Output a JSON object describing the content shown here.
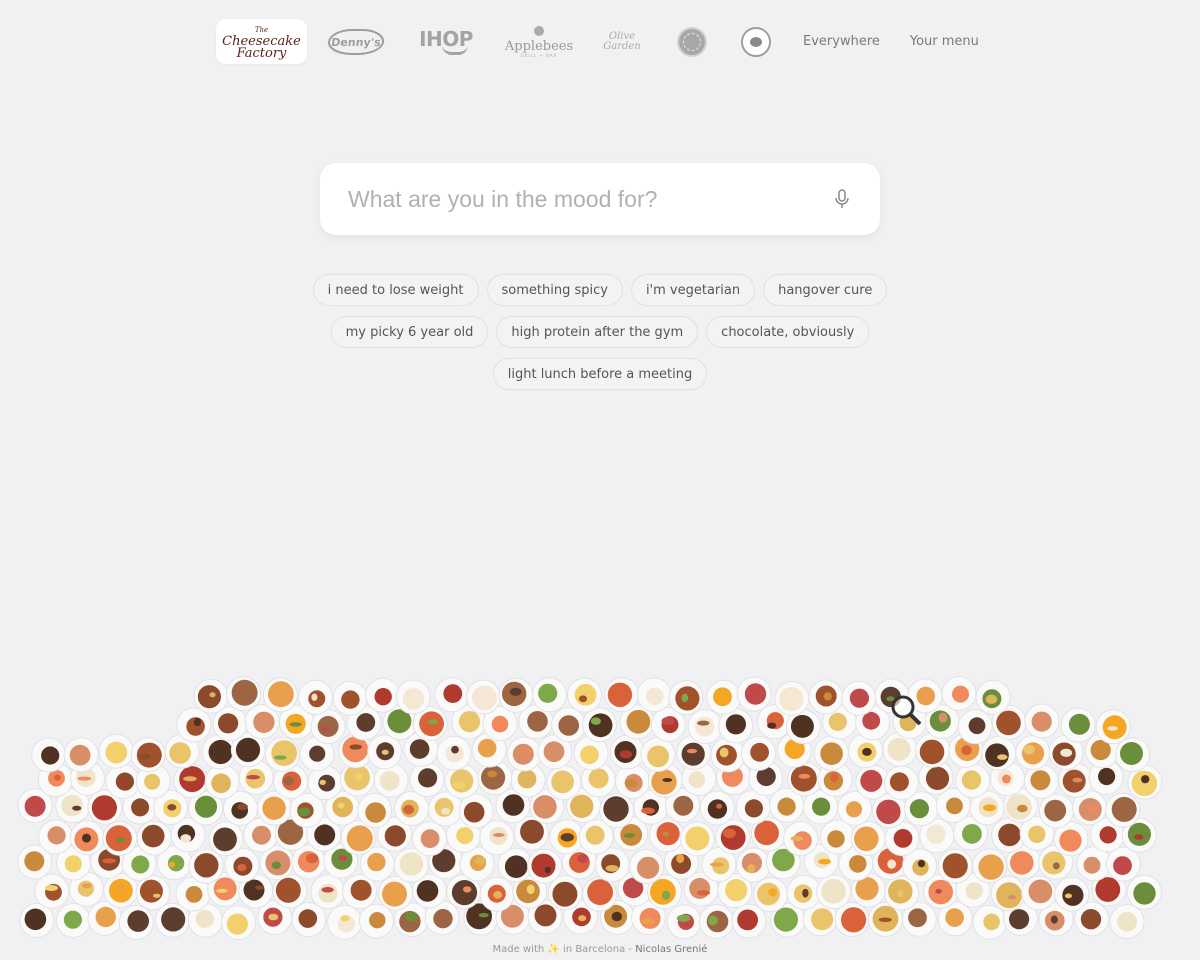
{
  "nav": {
    "brands": [
      {
        "name": "The Cheesecake Factory",
        "line_top": "The",
        "line1": "Cheesecake",
        "line2": "Factory",
        "active": true
      },
      {
        "name": "Denny's",
        "label": "Denny's"
      },
      {
        "name": "IHOP",
        "label": "IHOP"
      },
      {
        "name": "Applebees",
        "label": "Applebees",
        "sub": "GRILL + BAR"
      },
      {
        "name": "Olive Garden",
        "line1": "Olive",
        "line2": "Garden"
      },
      {
        "name": "Chipotle"
      },
      {
        "name": "Panda Express"
      }
    ],
    "everywhere": "Everywhere",
    "your_menu": "Your menu"
  },
  "search": {
    "placeholder": "What are you in the mood for?"
  },
  "suggestions": [
    [
      "i need to lose weight",
      "something spicy",
      "i'm vegetarian",
      "hangover cure"
    ],
    [
      "my picky 6 year old",
      "high protein after the gym",
      "chocolate, obviously"
    ],
    [
      "light lunch before a meeting"
    ]
  ],
  "footer": {
    "made_with": "Made with",
    "sparkle": "✨",
    "in_city": "in Barcelona -",
    "author": "Nicolas Grenié"
  },
  "colors": {
    "background": "#f1f1f3",
    "cheesecake_brand": "#5a1f16"
  },
  "icons": {
    "mic": "microphone-icon",
    "mosaic_search": "magnifier-icon"
  }
}
